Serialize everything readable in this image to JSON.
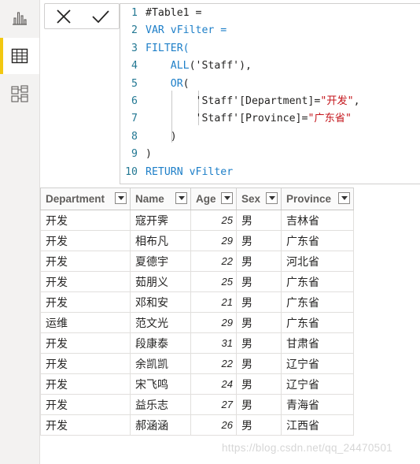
{
  "formula": {
    "lines": [
      {
        "n": "1",
        "parts": [
          [
            "plain",
            "#Table1 ="
          ]
        ]
      },
      {
        "n": "2",
        "parts": [
          [
            "kw",
            "VAR vFilter ="
          ]
        ]
      },
      {
        "n": "3",
        "parts": [
          [
            "kw",
            "FILTER("
          ]
        ]
      },
      {
        "n": "4",
        "parts": [
          [
            "plain",
            "    "
          ],
          [
            "kw",
            "ALL"
          ],
          [
            "plain",
            "('Staff'),"
          ]
        ]
      },
      {
        "n": "5",
        "parts": [
          [
            "plain",
            "    "
          ],
          [
            "kw",
            "OR"
          ],
          [
            "plain",
            "("
          ]
        ]
      },
      {
        "n": "6",
        "parts": [
          [
            "plain",
            "        'Staff'[Department]="
          ],
          [
            "str",
            "\"开发\""
          ],
          [
            "plain",
            ","
          ]
        ]
      },
      {
        "n": "7",
        "parts": [
          [
            "plain",
            "        'Staff'[Province]="
          ],
          [
            "str",
            "\"广东省\""
          ]
        ]
      },
      {
        "n": "8",
        "parts": [
          [
            "plain",
            "    )"
          ]
        ]
      },
      {
        "n": "9",
        "parts": [
          [
            "plain",
            ")"
          ]
        ]
      },
      {
        "n": "10",
        "parts": [
          [
            "kw",
            "RETURN vFilter"
          ]
        ]
      }
    ]
  },
  "table": {
    "columns": [
      "Department",
      "Name",
      "Age",
      "Sex",
      "Province"
    ],
    "rows": [
      [
        "开发",
        "寇开霁",
        "25",
        "男",
        "吉林省"
      ],
      [
        "开发",
        "相布凡",
        "29",
        "男",
        "广东省"
      ],
      [
        "开发",
        "夏德宇",
        "22",
        "男",
        "河北省"
      ],
      [
        "开发",
        "茹朋义",
        "25",
        "男",
        "广东省"
      ],
      [
        "开发",
        "邓和安",
        "21",
        "男",
        "广东省"
      ],
      [
        "运维",
        "范文光",
        "29",
        "男",
        "广东省"
      ],
      [
        "开发",
        "段康泰",
        "31",
        "男",
        "甘肃省"
      ],
      [
        "开发",
        "余凯凯",
        "22",
        "男",
        "辽宁省"
      ],
      [
        "开发",
        "宋飞鸣",
        "24",
        "男",
        "辽宁省"
      ],
      [
        "开发",
        "益乐志",
        "27",
        "男",
        "青海省"
      ],
      [
        "开发",
        "郝涵涵",
        "26",
        "男",
        "江西省"
      ]
    ]
  },
  "icons": {
    "rail": [
      "report-view-icon",
      "data-view-icon",
      "model-view-icon"
    ],
    "commit": [
      "cancel-icon",
      "commit-icon"
    ]
  },
  "watermark": "https://blog.csdn.net/qq_24470501",
  "colors": {
    "accent": "#f2c811",
    "keyword": "#1e7fc8",
    "string": "#c4161c",
    "line_number": "#237893"
  }
}
